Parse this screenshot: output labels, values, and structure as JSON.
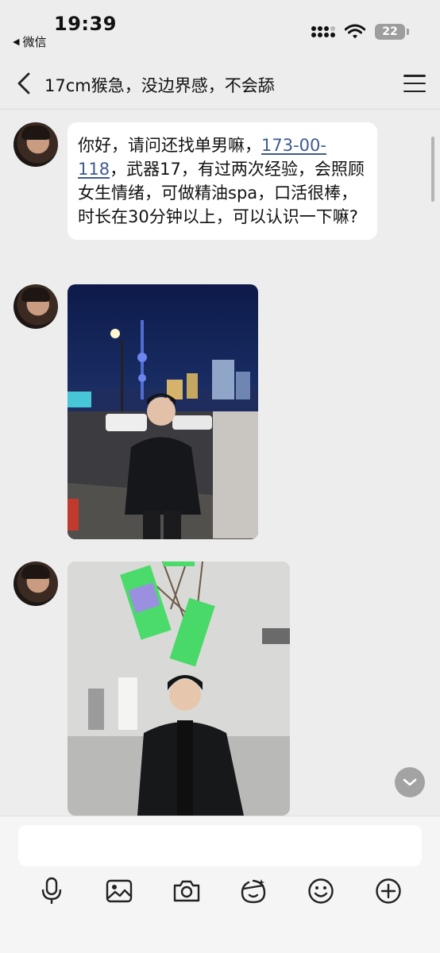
{
  "status_bar": {
    "time": "19:39",
    "back_app_label": "微信",
    "battery": "22"
  },
  "header": {
    "title": "17cm猴急，没边界感，不会舔"
  },
  "messages": [
    {
      "type": "text",
      "text_before_link": "你好，请问还找单男嘛，",
      "phone_link": "173-00-118",
      "text_after_link": "，武器17，有过两次经验，会照顾女生情绪，可做精油spa，口活很棒，时长在30分钟以上，可以认识一下嘛?"
    },
    {
      "type": "image",
      "icon": "photo-night-city"
    },
    {
      "type": "image",
      "icon": "photo-gallery-interior"
    }
  ],
  "input": {
    "placeholder": "",
    "value": ""
  },
  "toolbar": {
    "icons": [
      "microphone-icon",
      "image-icon",
      "camera-icon",
      "sticker-icon",
      "emoji-icon",
      "plus-icon"
    ]
  },
  "colors": {
    "background": "#ededed",
    "bubble": "#ffffff",
    "link": "#3f5a90",
    "input_bar": "#f5f5f5"
  }
}
